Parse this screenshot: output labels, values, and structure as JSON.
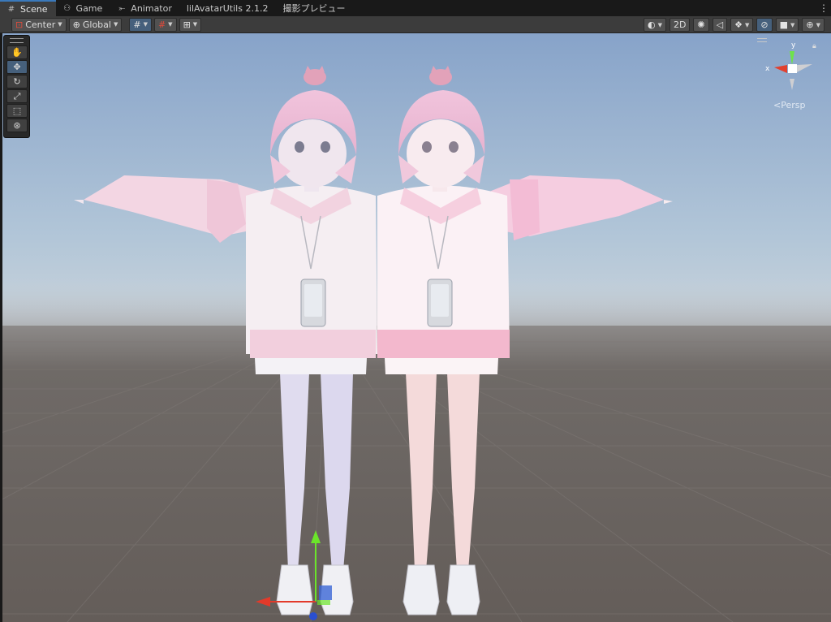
{
  "tabs": [
    {
      "label": "Scene",
      "icon": "scene-grid-icon",
      "glyph": "#",
      "active": true
    },
    {
      "label": "Game",
      "icon": "game-controller-icon",
      "glyph": "⚇",
      "active": false
    },
    {
      "label": "Animator",
      "icon": "animator-icon",
      "glyph": "⤜",
      "active": false
    },
    {
      "label": "lilAvatarUtils 2.1.2",
      "icon": "",
      "glyph": "",
      "active": false
    },
    {
      "label": "撮影プレビュー",
      "icon": "",
      "glyph": "",
      "active": false
    }
  ],
  "toolbar": {
    "pivot_label": "Center",
    "space_label": "Global",
    "mode_2d_label": "2D"
  },
  "gizmo": {
    "x_label": "x",
    "y_label": "y",
    "projection_label": "Persp"
  },
  "colors": {
    "accent": "#3a79bb",
    "toolbar_bg": "#3c3c3c",
    "sky_top": "#8fa9cc",
    "ground": "#6a6460",
    "active_button": "#46607c"
  }
}
